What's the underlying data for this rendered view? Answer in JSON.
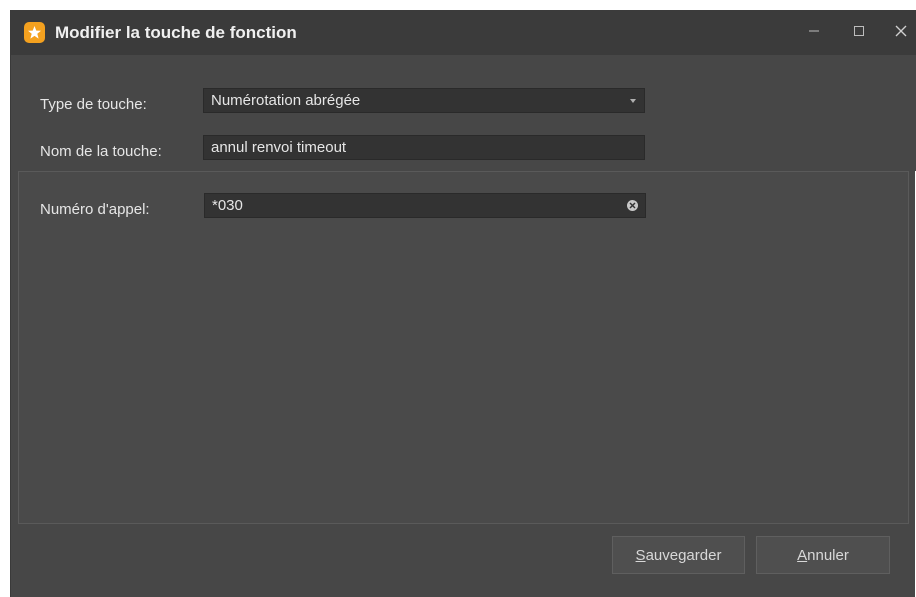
{
  "window": {
    "title": "Modifier la touche de fonction"
  },
  "form": {
    "type_label": "Type de touche:",
    "type_value": "Numérotation abrégée",
    "name_label": "Nom de la touche:",
    "name_value": "annul renvoi timeout"
  },
  "details": {
    "number_label": "Numéro d'appel:",
    "number_value": "*030"
  },
  "buttons": {
    "save_label": "Sauvegarder",
    "cancel_label": "Annuler"
  },
  "colors": {
    "app_icon": "#f4a11f",
    "background": "#474747",
    "titlebar": "#3b3b3b"
  },
  "icons": [
    "app-logo-icon",
    "minimize-icon",
    "maximize-icon",
    "close-icon",
    "dropdown-arrow-icon",
    "clear-icon"
  ]
}
